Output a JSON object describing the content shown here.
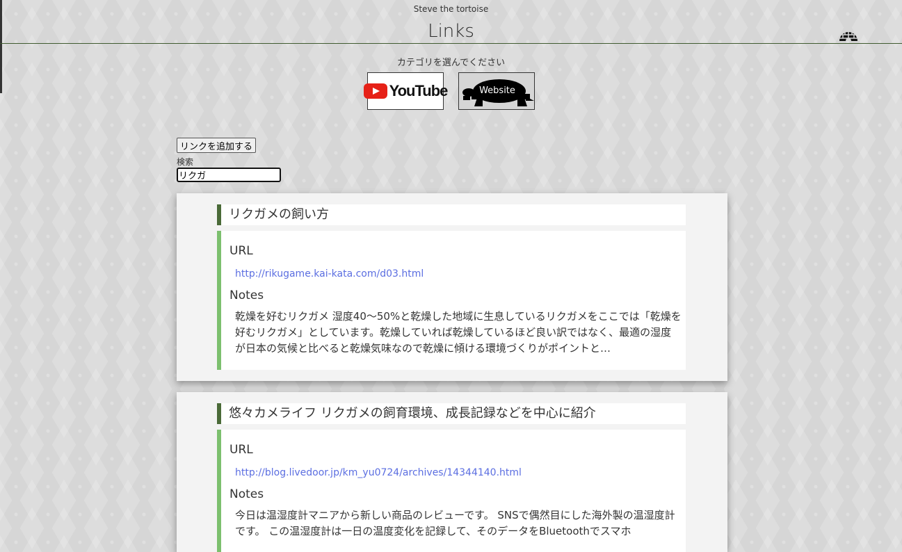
{
  "header": {
    "site_name": "Steve the tortoise",
    "title": "Links"
  },
  "category": {
    "prompt": "カテゴリを選んでください",
    "youtube_label": "YouTube",
    "website_label": "Website"
  },
  "toolbar": {
    "add_link_label": "リンクを追加する",
    "search_label": "検索",
    "search_value": "リクガ"
  },
  "links": [
    {
      "title": "リクガメの飼い方",
      "url_label": "URL",
      "url": "http://rikugame.kai-kata.com/d03.html",
      "notes_label": "Notes",
      "notes": "乾燥を好むリクガメ 湿度40～50%と乾燥した地域に生息しているリクガメをここでは「乾燥を好むリクガメ」としています。乾燥していれば乾燥しているほど良い訳ではなく、最適の湿度が日本の気候と比べると乾燥気味なので乾燥に傾ける環境づくりがポイントと…"
    },
    {
      "title": "悠々カメライフ リクガメの飼育環境、成長記録などを中心に紹介",
      "url_label": "URL",
      "url": "http://blog.livedoor.jp/km_yu0724/archives/14344140.html",
      "notes_label": "Notes",
      "notes": "今日は温湿度計マニアから新しい商品のレビューです。 SNSで偶然目にした海外製の温湿度計です。 この温湿度計は一日の温度変化を記録して、そのデータをBluetoothでスマホ"
    }
  ],
  "colors": {
    "title_bar_accent": "#4a6a38",
    "body_bar_accent": "#7cbf6e",
    "link_color": "#5b6ee1"
  },
  "icons": {
    "home": "igloo-icon",
    "website_category": "tortoise-icon"
  }
}
